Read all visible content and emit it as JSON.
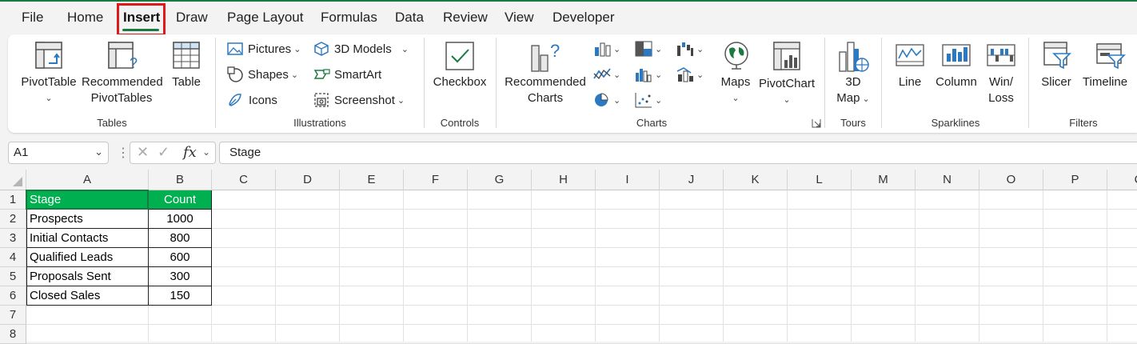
{
  "tabs": [
    "File",
    "Home",
    "Insert",
    "Draw",
    "Page Layout",
    "Formulas",
    "Data",
    "Review",
    "View",
    "Developer"
  ],
  "active_tab": "Insert",
  "ribbon": {
    "tables": {
      "pivottable": "PivotTable",
      "recommended_line1": "Recommended",
      "recommended_line2": "PivotTables",
      "table": "Table",
      "label": "Tables"
    },
    "illustrations": {
      "pictures": "Pictures",
      "shapes": "Shapes",
      "icons": "Icons",
      "models_3d": "3D Models",
      "smartart": "SmartArt",
      "screenshot": "Screenshot",
      "label": "Illustrations"
    },
    "controls": {
      "checkbox": "Checkbox",
      "label": "Controls"
    },
    "charts": {
      "recommended_line1": "Recommended",
      "recommended_line2": "Charts",
      "maps": "Maps",
      "pivotchart": "PivotChart",
      "label": "Charts"
    },
    "tours": {
      "map_line1": "3D",
      "map_line2": "Map",
      "label": "Tours"
    },
    "sparklines": {
      "line": "Line",
      "column": "Column",
      "winloss_line1": "Win/",
      "winloss_line2": "Loss",
      "label": "Sparklines"
    },
    "filters": {
      "slicer": "Slicer",
      "timeline": "Timeline",
      "label": "Filters"
    }
  },
  "formula_bar": {
    "name_box": "A1",
    "fx": "fx",
    "formula": "Stage"
  },
  "columns": [
    "A",
    "B",
    "C",
    "D",
    "E",
    "F",
    "G",
    "H",
    "I",
    "J",
    "K",
    "L",
    "M",
    "N",
    "O",
    "P",
    "Q"
  ],
  "rows": [
    "1",
    "2",
    "3",
    "4",
    "5",
    "6",
    "7",
    "8"
  ],
  "table": {
    "headers": [
      "Stage",
      "Count"
    ],
    "rows": [
      [
        "Prospects",
        "1000"
      ],
      [
        "Initial Contacts",
        "800"
      ],
      [
        "Qualified Leads",
        "600"
      ],
      [
        "Proposals Sent",
        "300"
      ],
      [
        "Closed Sales",
        "150"
      ]
    ]
  },
  "colors": {
    "accent": "#1a7a41",
    "header_fill": "#00b050",
    "highlight": "#e01a1a"
  }
}
